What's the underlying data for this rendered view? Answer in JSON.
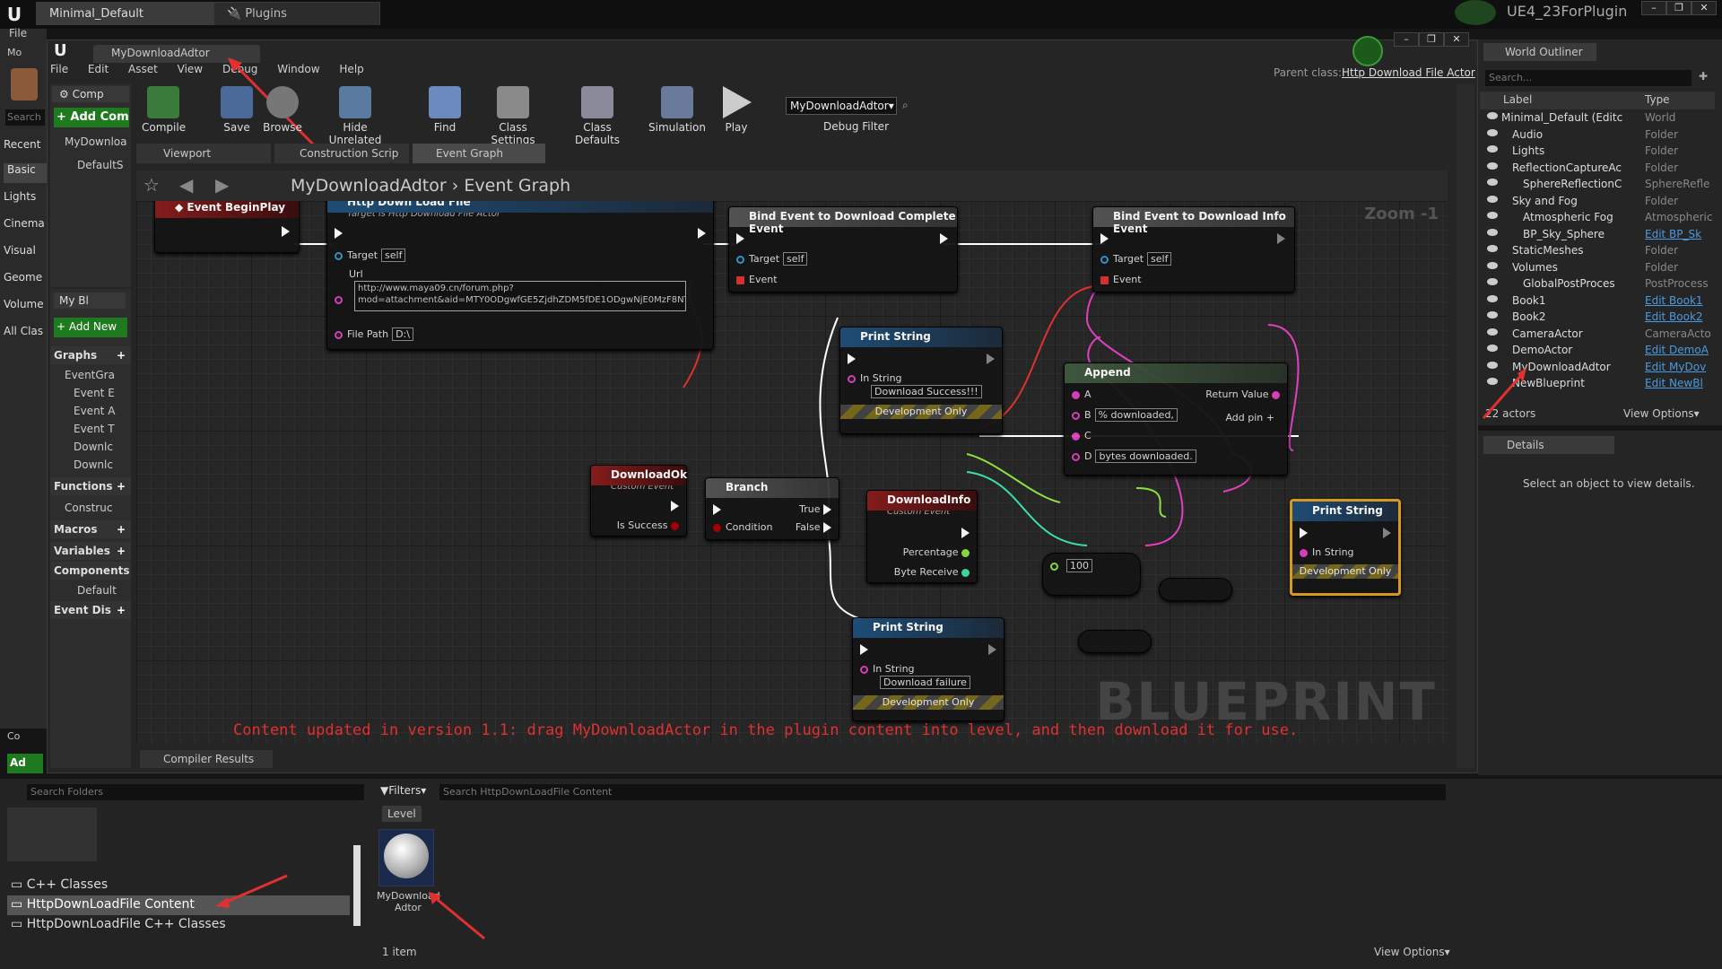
{
  "window_tabs": [
    "Minimal_Default",
    "Plugins"
  ],
  "project_name": "UE4_23ForPlugin",
  "window_buttons": [
    "–",
    "❐",
    "✕"
  ],
  "bp_window": {
    "tab": "MyDownloadAdtor",
    "menu": [
      "File",
      "Edit",
      "Asset",
      "View",
      "Debug",
      "Window",
      "Help"
    ],
    "parent_class_label": "Parent class:",
    "parent_class": "Http Download File Actor",
    "toolbar": [
      "Compile",
      "Save",
      "Browse",
      "Hide Unrelated",
      "Find",
      "Class Settings",
      "Class Defaults",
      "Simulation",
      "Play"
    ],
    "debug_dropdown": "MyDownloadAdtor▾",
    "debug_filter": "Debug Filter",
    "editor_tabs": [
      "Viewport",
      "Construction Scrip",
      "Event Graph"
    ],
    "breadcrumb": [
      "MyDownloadAdtor",
      "Event Graph"
    ],
    "zoom": "Zoom -1",
    "compiler_results": "Compiler Results",
    "notice": "Content updated in version 1.1: drag MyDownloadActor in the plugin content into level, and then download it for use.",
    "watermark": "BLUEPRINT"
  },
  "left_strip": {
    "file": "File",
    "mo": "Mo",
    "search": "Search",
    "items": [
      "Recent",
      "Basic",
      "Lights",
      "Cinema",
      "Visual",
      "Geome",
      "Volume",
      "All Clas"
    ],
    "bottom_co": "Co",
    "bottom_ad": "Ad"
  },
  "components": {
    "tab": "Comp",
    "add": "+ Add Comp",
    "items": [
      "MyDownloa",
      "DefaultS"
    ]
  },
  "mybp": {
    "tab": "My Bl",
    "add": "+ Add New",
    "graphs": "Graphs",
    "graph_items": [
      "EventGra",
      "Event E",
      "Event A",
      "Event T",
      "Downlc",
      "Downlc"
    ],
    "functions": "Functions",
    "func_items": [
      "Construc"
    ],
    "macros": "Macros",
    "variables": "Variables",
    "components": "Components",
    "comp_items": [
      "Default"
    ],
    "dispatchers": "Event Dis"
  },
  "nodes": {
    "begin": {
      "title": "Event BeginPlay"
    },
    "http": {
      "title": "Http Down Load File",
      "sub": "Target is Http Download File Actor",
      "target": "Target",
      "self": "self",
      "url": "Url",
      "url_val1": "http://www.maya09.cn/forum.php?",
      "url_val2": "mod=attachment&aid=MTY0ODgwfGE5ZjdhZDM5fDE1ODgwNjE0MzF8NT",
      "filepath": "File Path",
      "fp_val": "D:\\"
    },
    "bind1": {
      "title": "Bind Event to Download Complete Event",
      "target": "Target",
      "self": "self",
      "event": "Event"
    },
    "bind2": {
      "title": "Bind Event to Download Info Event",
      "target": "Target",
      "self": "self",
      "event": "Event"
    },
    "ps1": {
      "title": "Print String",
      "in": "In String",
      "val": "Download Success!!!",
      "dev": "Development Only"
    },
    "append": {
      "title": "Append",
      "a": "A",
      "b": "B",
      "bval": "% downloaded,",
      "c": "C",
      "d": "D",
      "dval": "bytes downloaded.",
      "ret": "Return Value",
      "add": "Add pin"
    },
    "dlok": {
      "title": "DownloadOk",
      "sub": "Custom Event",
      "succ": "Is Success"
    },
    "branch": {
      "title": "Branch",
      "cond": "Condition",
      "t": "True",
      "f": "False"
    },
    "dlinfo": {
      "title": "DownloadInfo",
      "sub": "Custom Event",
      "pct": "Percentage",
      "bytes": "Byte Receive"
    },
    "div": {
      "val": "100"
    },
    "ps2": {
      "title": "Print String",
      "in": "In String",
      "val": "Download failure",
      "dev": "Development Only"
    },
    "ps3": {
      "title": "Print String",
      "in": "In String",
      "dev": "Development Only"
    }
  },
  "world_outliner": {
    "tab": "World Outliner",
    "search": "Search...",
    "col_label": "Label",
    "col_type": "Type",
    "rows": [
      {
        "label": "Minimal_Default (Editc",
        "type": "World",
        "indent": 1
      },
      {
        "label": "Audio",
        "type": "Folder",
        "indent": 2
      },
      {
        "label": "Lights",
        "type": "Folder",
        "indent": 2
      },
      {
        "label": "ReflectionCaptureAc",
        "type": "Folder",
        "indent": 2
      },
      {
        "label": "SphereReflectionC",
        "type": "SphereRefle",
        "indent": 3
      },
      {
        "label": "Sky and Fog",
        "type": "Folder",
        "indent": 2
      },
      {
        "label": "Atmospheric Fog",
        "type": "Atmospheric",
        "indent": 3
      },
      {
        "label": "BP_Sky_Sphere",
        "type": "Edit BP_Sk",
        "indent": 3
      },
      {
        "label": "StaticMeshes",
        "type": "Folder",
        "indent": 2
      },
      {
        "label": "Volumes",
        "type": "Folder",
        "indent": 2
      },
      {
        "label": "GlobalPostProces",
        "type": "PostProcess",
        "indent": 3
      },
      {
        "label": "Book1",
        "type": "Edit Book1",
        "indent": 2
      },
      {
        "label": "Book2",
        "type": "Edit Book2",
        "indent": 2
      },
      {
        "label": "CameraActor",
        "type": "CameraActo",
        "indent": 2
      },
      {
        "label": "DemoActor",
        "type": "Edit DemoA",
        "indent": 2
      },
      {
        "label": "MyDownloadAdtor",
        "type": "Edit MyDov",
        "indent": 2
      },
      {
        "label": "NewBlueprint",
        "type": "Edit NewBl",
        "indent": 2
      }
    ],
    "actors": "22 actors",
    "view_options": "View Options▾"
  },
  "details": {
    "tab": "Details",
    "msg": "Select an object to view details."
  },
  "content_browser": {
    "search_folders": "Search Folders",
    "filters": "Filters▾",
    "search_content": "Search HttpDownLoadFile Content",
    "level": "Level",
    "asset_name1": "MyDownload",
    "asset_name2": "Adtor",
    "folders": [
      "C++ Classes",
      "HttpDownLoadFile Content",
      "HttpDownLoadFile C++ Classes"
    ],
    "item_count": "1 item",
    "view_options": "View Options▾"
  },
  "colors": {
    "accent_orange": "#e0a020",
    "arrow_red": "#e03030",
    "pin_blue": "#3aa0e0",
    "pin_pink": "#e040c0",
    "pin_green": "#8ce040"
  }
}
